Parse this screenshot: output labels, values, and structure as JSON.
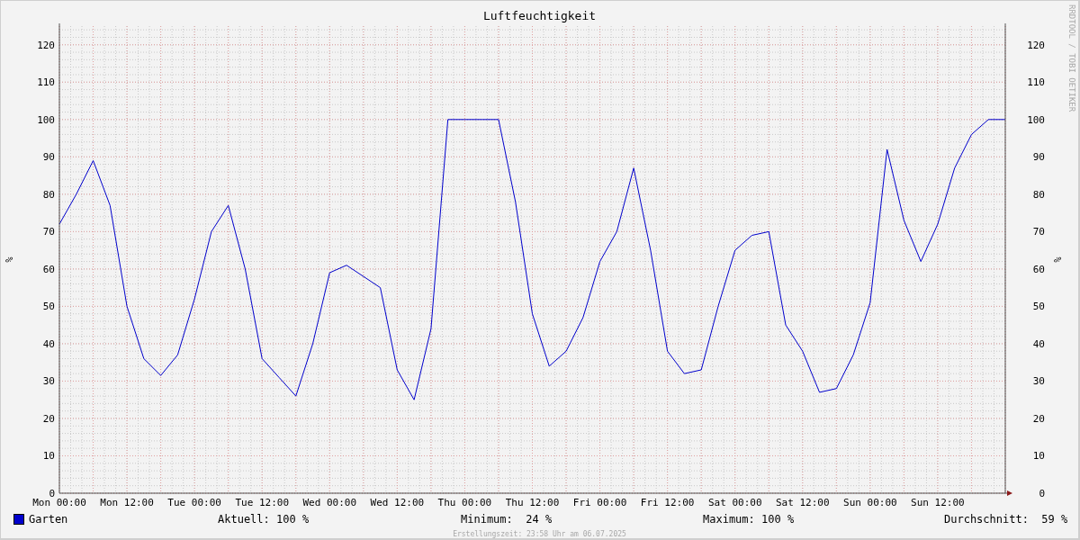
{
  "graph": {
    "title": "Luftfeuchtigkeit",
    "credit": "RRDTOOL / TOBI OETIKER",
    "chart_data": {
      "type": "line",
      "ylabel": "%",
      "categories": [
        "Mon 00:00",
        null,
        null,
        null,
        "Mon 12:00",
        null,
        null,
        null,
        "Tue 00:00",
        null,
        null,
        null,
        "Tue 12:00",
        null,
        null,
        null,
        "Wed 00:00",
        null,
        null,
        null,
        "Wed 12:00",
        null,
        null,
        null,
        "Thu 00:00",
        null,
        null,
        null,
        "Thu 12:00",
        null,
        null,
        null,
        "Fri 00:00",
        null,
        null,
        null,
        "Fri 12:00",
        null,
        null,
        null,
        "Sat 00:00",
        null,
        null,
        null,
        "Sat 12:00",
        null,
        null,
        null,
        "Sun 00:00",
        null,
        null,
        null,
        "Sun 12:00",
        null,
        null,
        null,
        null
      ],
      "series": [
        {
          "name": "Garten",
          "color": "#0000cc",
          "values": [
            72,
            80,
            89,
            77,
            50,
            36,
            31.5,
            37,
            52,
            70,
            77,
            60,
            36,
            31,
            26,
            40,
            59,
            61,
            58,
            55,
            33,
            25,
            44,
            100,
            100,
            100,
            100,
            78,
            48,
            34,
            38,
            47,
            62,
            70,
            87,
            65,
            38,
            32,
            33,
            50,
            65,
            69,
            70,
            45,
            38,
            27,
            28,
            37,
            51,
            92,
            73,
            62,
            72,
            87,
            96,
            100,
            100
          ]
        }
      ],
      "ylim": [
        0,
        125
      ],
      "grid": true,
      "yticks": [
        0,
        10,
        20,
        30,
        40,
        50,
        60,
        70,
        80,
        90,
        100,
        110,
        120
      ]
    },
    "right_axis": {
      "label": "%",
      "ticks": [
        "120",
        "110",
        "100",
        "90",
        "80",
        "70",
        "60",
        "50",
        "40",
        "30",
        "20",
        "10",
        "0"
      ]
    }
  },
  "legend": {
    "stats": [
      "Aktuell: 100 %",
      "Minimum:  24 %",
      "Maximum: 100 %",
      "Durchschnitt:  59 %"
    ]
  },
  "footer": "Erstellungszeit: 23:58 Uhr am 06.07.2025"
}
